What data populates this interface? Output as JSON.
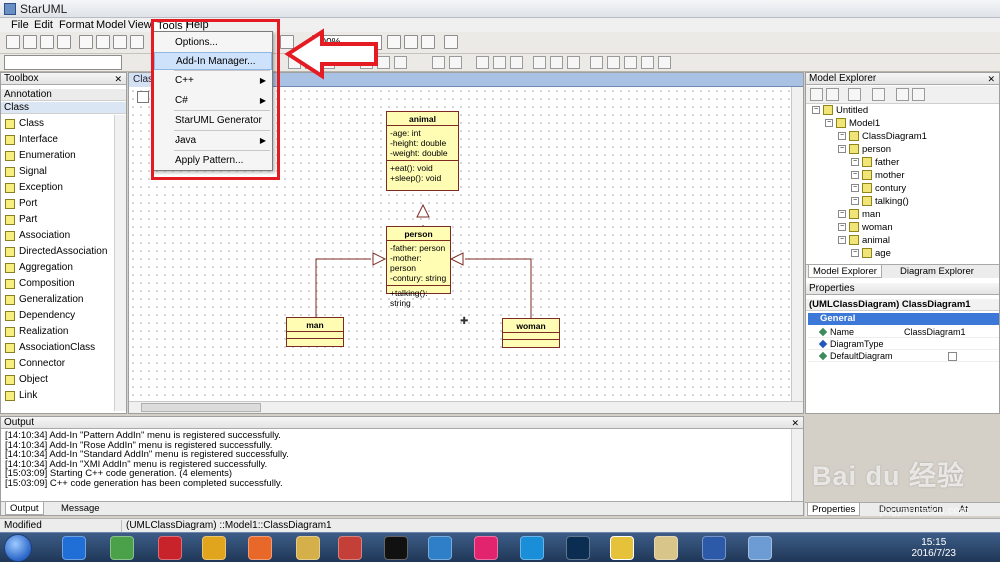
{
  "app": {
    "title": "StarUML"
  },
  "menubar": [
    "File",
    "Edit",
    "Format",
    "Model",
    "View",
    "Tools",
    "Help"
  ],
  "toolbar": {
    "zoom": "100%"
  },
  "tools_menu": {
    "items": [
      {
        "label": "Options...",
        "highlighted": false,
        "submenu": false
      },
      {
        "label": "Add-In Manager...",
        "highlighted": true,
        "submenu": false
      },
      {
        "label": "C++",
        "highlighted": false,
        "submenu": true
      },
      {
        "label": "C#",
        "highlighted": false,
        "submenu": true
      },
      {
        "label": "StarUML Generator ...",
        "highlighted": false,
        "submenu": false
      },
      {
        "label": "Java",
        "highlighted": false,
        "submenu": true
      },
      {
        "label": "Apply Pattern...",
        "highlighted": false,
        "submenu": false
      }
    ]
  },
  "toolbox": {
    "title": "Toolbox",
    "annotation_label": "Annotation",
    "class_label": "Class",
    "items": [
      "Class",
      "Interface",
      "Enumeration",
      "Signal",
      "Exception",
      "Port",
      "Part",
      "Association",
      "DirectedAssociation",
      "Aggregation",
      "Composition",
      "Generalization",
      "Dependency",
      "Realization",
      "AssociationClass",
      "Connector",
      "Object",
      "Link"
    ]
  },
  "diagram": {
    "tab": "ClassDiagram1",
    "classes": [
      {
        "name": "animal",
        "attributes": [
          "-age: int",
          "-height: double",
          "-weight: double"
        ],
        "operations": [
          "+eat(): void",
          "+sleep(): void"
        ]
      },
      {
        "name": "person",
        "attributes": [
          "-father: person",
          "-mother: person",
          "-contury: string"
        ],
        "operations": [
          "+talking(): string"
        ]
      },
      {
        "name": "man",
        "attributes": [],
        "operations": []
      },
      {
        "name": "woman",
        "attributes": [],
        "operations": []
      }
    ]
  },
  "model_explorer": {
    "title": "Model Explorer",
    "nodes": [
      {
        "label": "Untitled",
        "depth": 0
      },
      {
        "label": "Model1",
        "depth": 1
      },
      {
        "label": "ClassDiagram1",
        "depth": 2
      },
      {
        "label": "person",
        "depth": 2
      },
      {
        "label": "father",
        "depth": 3
      },
      {
        "label": "mother",
        "depth": 3
      },
      {
        "label": "contury",
        "depth": 3
      },
      {
        "label": "talking()",
        "depth": 3
      },
      {
        "label": "man",
        "depth": 2
      },
      {
        "label": "woman",
        "depth": 2
      },
      {
        "label": "animal",
        "depth": 2
      },
      {
        "label": "age",
        "depth": 3
      }
    ],
    "tabs": [
      "Model Explorer",
      "Diagram Explorer"
    ]
  },
  "properties": {
    "title": "Properties",
    "subject": "(UMLClassDiagram) ClassDiagram1",
    "category": "General",
    "rows": [
      {
        "key": "Name",
        "value": "ClassDiagram1"
      },
      {
        "key": "DiagramType",
        "value": ""
      },
      {
        "key": "DefaultDiagram",
        "value": ""
      }
    ],
    "bottom_tabs": [
      "Properties",
      "Documentation",
      "At"
    ]
  },
  "output": {
    "title": "Output",
    "lines": [
      "[14:10:34]  Add-In \"Pattern AddIn\" menu is registered successfully.",
      "[14:10:34]  Add-In \"Rose AddIn\" menu is registered successfully.",
      "[14:10:34]  Add-In \"Standard AddIn\" menu is registered successfully.",
      "[14:10:34]  Add-In \"XMI AddIn\" menu is registered successfully.",
      "[15:03:09]  Starting C++ code generation. (4 elements)",
      "[15:03:09]  C++ code generation has been completed successfully."
    ],
    "tabs": [
      "Output",
      "Message"
    ]
  },
  "status": {
    "left": "Modified",
    "right": "(UMLClassDiagram) ::Model1::ClassDiagram1"
  },
  "taskbar": {
    "time": "15:15",
    "date": "2016/7/23"
  },
  "watermark": {
    "text": "Bai du 经验",
    "url": "jingyan.baidu.com"
  },
  "colors": {
    "highlight_box": "#e41b23",
    "class_fill": "#fffcb4",
    "class_border": "#7d2a22",
    "selection": "#3b78d8"
  }
}
